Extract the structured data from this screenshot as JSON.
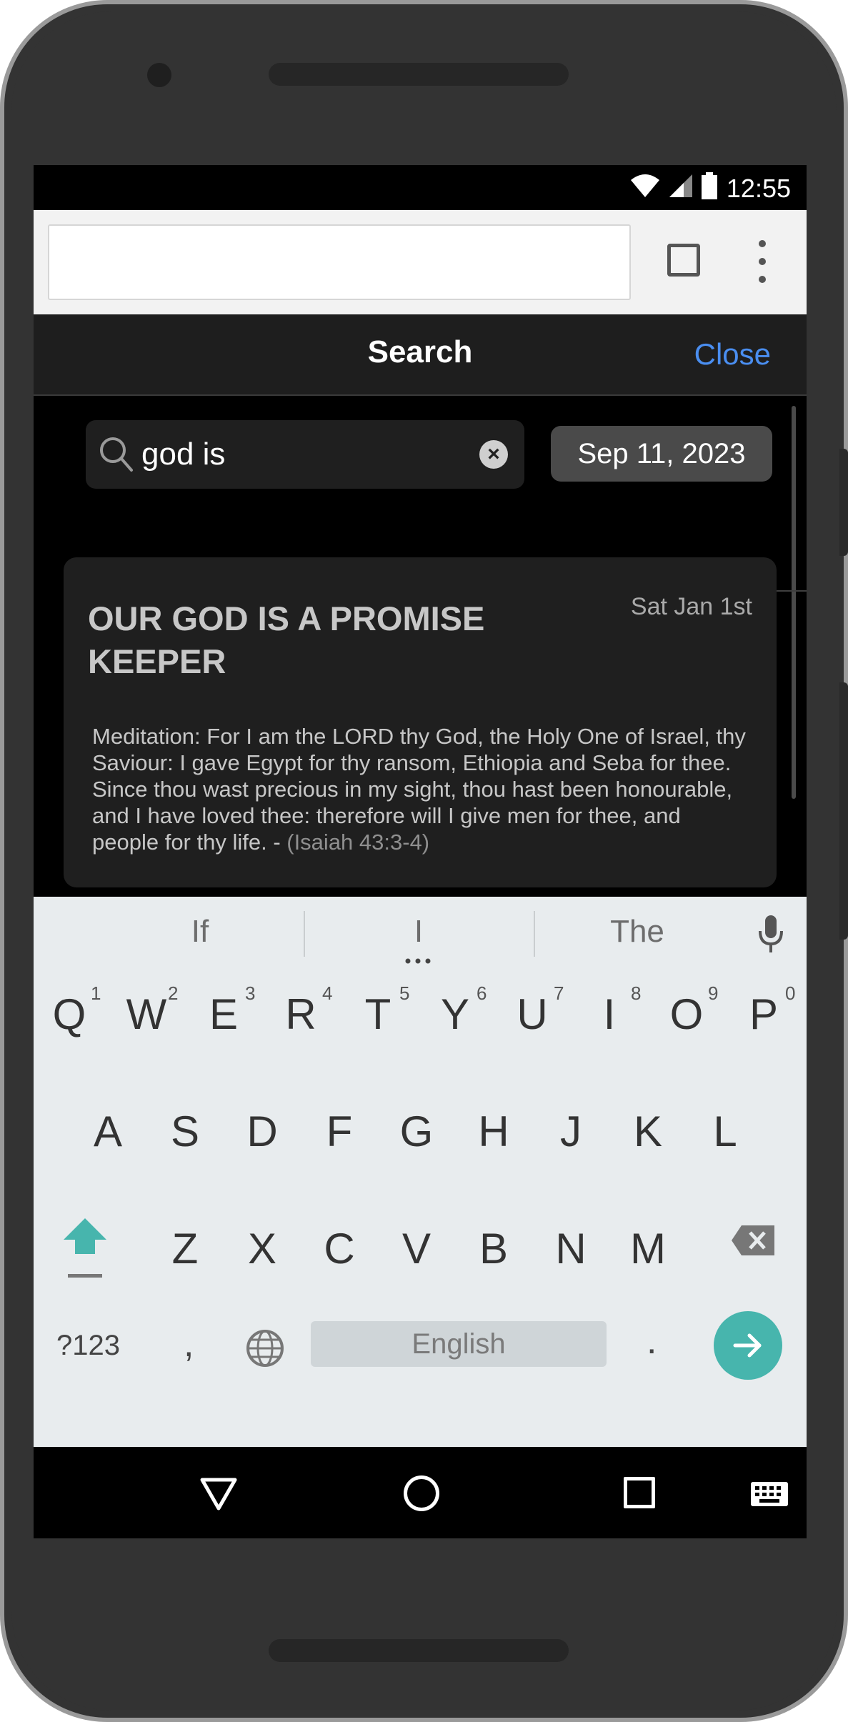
{
  "status_bar": {
    "time": "12:55"
  },
  "browser": {
    "url": ""
  },
  "header": {
    "title": "Search",
    "close_label": "Close"
  },
  "search": {
    "query": "god is",
    "clear_symbol": "×",
    "date": "Sep 11, 2023"
  },
  "results": [
    {
      "title": "OUR GOD IS A PROMISE KEEPER",
      "date": "Sat Jan 1st",
      "body": "Meditation: For I am the LORD thy God, the Holy One of Israel, thy Saviour: I gave Egypt for thy ransom, Ethiopia and Seba for thee. Since thou wast precious in my sight, thou hast been honourable, and I have loved thee: therefore will I give men for thee, and people for thy life. - ",
      "reference": "(Isaiah 43:3-4)"
    }
  ],
  "keyboard": {
    "suggestions": [
      "If",
      "I",
      "The"
    ],
    "row1": [
      "Q",
      "W",
      "E",
      "R",
      "T",
      "Y",
      "U",
      "I",
      "O",
      "P"
    ],
    "row1_numbers": [
      "1",
      "2",
      "3",
      "4",
      "5",
      "6",
      "7",
      "8",
      "9",
      "0"
    ],
    "row2": [
      "A",
      "S",
      "D",
      "F",
      "G",
      "H",
      "J",
      "K",
      "L"
    ],
    "row3": [
      "Z",
      "X",
      "C",
      "V",
      "B",
      "N",
      "M"
    ],
    "symbols_label": "?123",
    "comma": ",",
    "space_label": "English",
    "period": ".",
    "accent_color": "#47b5ad"
  },
  "icons": {
    "status": [
      "wifi-icon",
      "signal-icon",
      "battery-icon"
    ],
    "browser": [
      "tabs-icon",
      "menu-icon"
    ],
    "search": [
      "search-icon",
      "clear-icon"
    ],
    "keyboard": [
      "mic-icon",
      "shift-icon",
      "backspace-icon",
      "globe-icon",
      "enter-arrow-icon"
    ],
    "nav": [
      "back-icon",
      "home-icon",
      "recents-icon",
      "keyboard-switch-icon"
    ]
  }
}
